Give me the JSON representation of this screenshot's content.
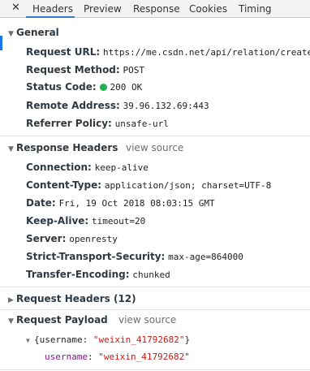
{
  "tabs": {
    "close": "✕",
    "items": [
      "Headers",
      "Preview",
      "Response",
      "Cookies",
      "Timing"
    ]
  },
  "general": {
    "title": "General",
    "rows": [
      {
        "key": "Request URL:",
        "value": "https://me.csdn.net/api/relation/create"
      },
      {
        "key": "Request Method:",
        "value": "POST"
      },
      {
        "key": "Status Code:",
        "value": "200 OK"
      },
      {
        "key": "Remote Address:",
        "value": "39.96.132.69:443"
      },
      {
        "key": "Referrer Policy:",
        "value": "unsafe-url"
      }
    ]
  },
  "response_headers": {
    "title": "Response Headers",
    "view_source": "view source",
    "rows": [
      {
        "key": "Connection:",
        "value": "keep-alive"
      },
      {
        "key": "Content-Type:",
        "value": "application/json; charset=UTF-8"
      },
      {
        "key": "Date:",
        "value": "Fri, 19 Oct 2018 08:03:15 GMT"
      },
      {
        "key": "Keep-Alive:",
        "value": "timeout=20"
      },
      {
        "key": "Server:",
        "value": "openresty"
      },
      {
        "key": "Strict-Transport-Security:",
        "value": "max-age=864000"
      },
      {
        "key": "Transfer-Encoding:",
        "value": "chunked"
      }
    ]
  },
  "request_headers": {
    "title": "Request Headers (12)"
  },
  "request_payload": {
    "title": "Request Payload",
    "view_source": "view source",
    "summary_open": "{username: ",
    "summary_value": "\"weixin_41792682\"",
    "summary_close": "}",
    "field_key": "username",
    "field_sep": ": ",
    "field_value": "\"weixin_41792682\""
  },
  "colors": {
    "accent": "#3879d9",
    "status_ok": "#1eb14d",
    "json_key": "#881391",
    "json_string": "#c41a16"
  },
  "icons": {
    "expanded": "triangle-down-icon",
    "collapsed": "triangle-right-icon",
    "status": "green-dot-icon"
  }
}
